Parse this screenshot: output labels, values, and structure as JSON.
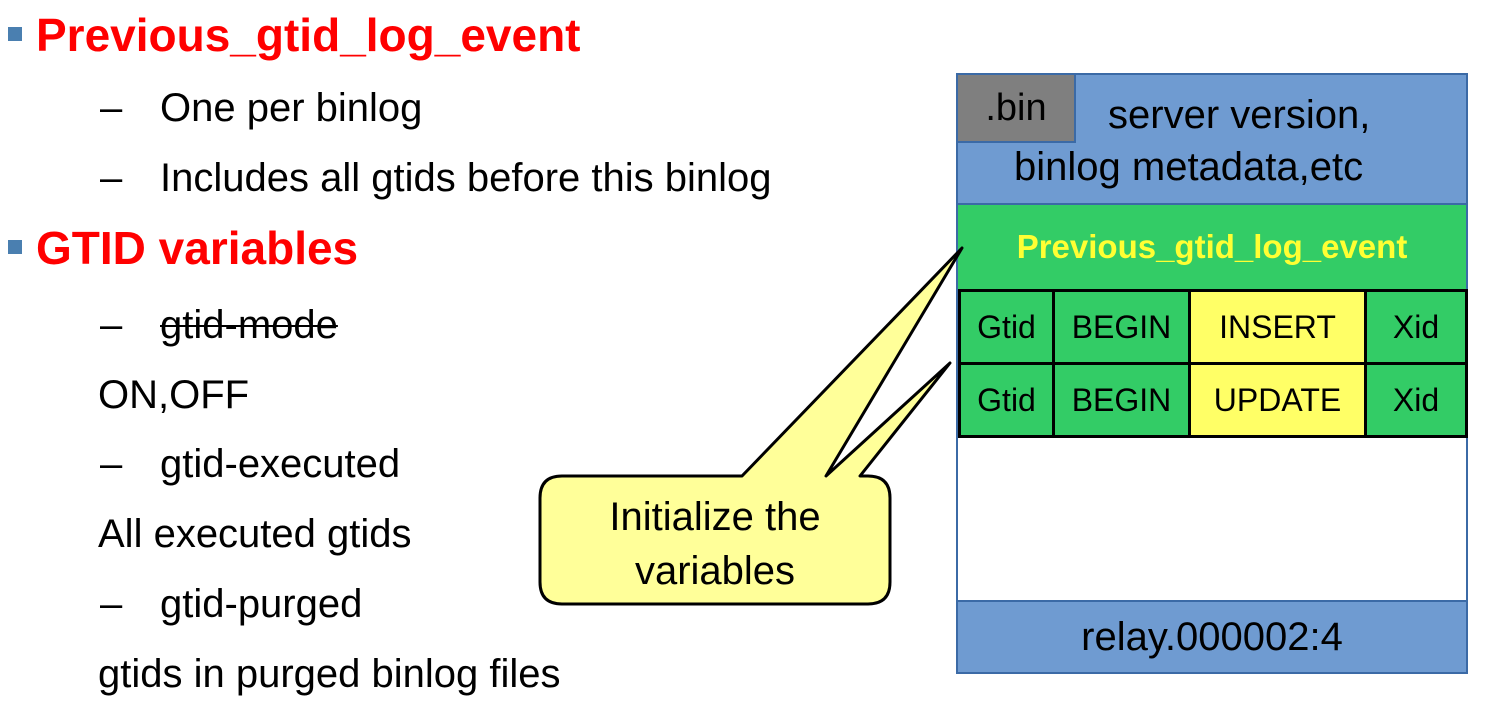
{
  "sections": [
    {
      "heading": "Previous_gtid_log_event",
      "items": [
        {
          "dash": "–",
          "text": "One per binlog"
        },
        {
          "dash": "–",
          "text": "Includes all gtids before this binlog"
        }
      ]
    },
    {
      "heading": "GTID variables",
      "items": [
        {
          "dash": "–",
          "text": "gtid-mode"
        },
        {
          "text": "ON,OFF"
        },
        {
          "dash": "–",
          "text": "gtid-executed"
        },
        {
          "text": "All executed gtids"
        },
        {
          "dash": "–",
          "text": "gtid-purged"
        },
        {
          "text": "gtids in purged binlog files"
        }
      ]
    }
  ],
  "binlog": {
    "tag": ".bin",
    "meta_line1": "server version,",
    "meta_line2": "binlog metadata,etc",
    "previous_event": "Previous_gtid_log_event",
    "rows": [
      [
        "Gtid",
        "BEGIN",
        "INSERT",
        "Xid"
      ],
      [
        "Gtid",
        "BEGIN",
        "UPDATE",
        "Xid"
      ]
    ],
    "footer": "relay.000002:4"
  },
  "callout": {
    "line1": "Initialize the",
    "line2": "variables"
  },
  "colors": {
    "heading": "#ff0000",
    "bullet": "#4a7fb0",
    "header_blue": "#6f9bd1",
    "event_green": "#33cc66",
    "event_text_yellow": "#ffff33",
    "cell_yellow": "#ffff66",
    "tag_gray": "#7f7f7f",
    "callout_fill": "#ffff99"
  }
}
